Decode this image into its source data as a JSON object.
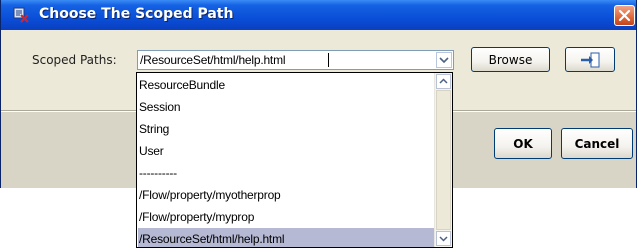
{
  "dialog": {
    "title": "Choose The Scoped Path",
    "close_icon": "close-icon",
    "app_icon": "dialog-app-icon"
  },
  "form": {
    "label": "Scoped Paths:",
    "value": "/ResourceSet/html/help.html",
    "browse_label": "Browse",
    "import_icon": "import-arrow-icon"
  },
  "dropdown": {
    "items": [
      {
        "label": "ResourceBundle",
        "selected": false
      },
      {
        "label": "Session",
        "selected": false
      },
      {
        "label": "String",
        "selected": false
      },
      {
        "label": "User",
        "selected": false
      },
      {
        "label": " ----------",
        "selected": false
      },
      {
        "label": "/Flow/property/myotherprop",
        "selected": false
      },
      {
        "label": "/Flow/property/myprop",
        "selected": false
      },
      {
        "label": "/ResourceSet/html/help.html",
        "selected": true
      }
    ]
  },
  "footer": {
    "ok_label": "OK",
    "cancel_label": "Cancel"
  },
  "colors": {
    "titlebar": "#0a4fd8",
    "close_button": "#e06b3c",
    "selected_row": "#b5b9d4",
    "dialog_bg": "#ece9d8"
  }
}
